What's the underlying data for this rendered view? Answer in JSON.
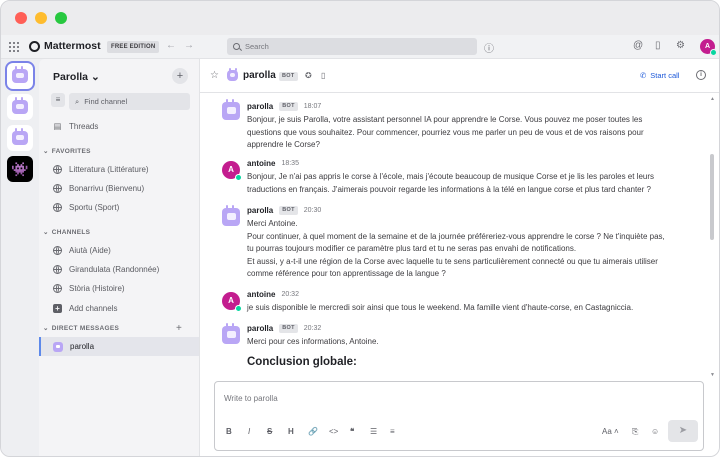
{
  "app": {
    "brand": "Mattermost",
    "edition": "FREE EDITION",
    "search_placeholder": "Search",
    "user_initial": "A"
  },
  "sidebar": {
    "team_name": "Parolla",
    "find_placeholder": "Find channel",
    "threads_label": "Threads",
    "favorites_header": "FAVORITES",
    "favorites": [
      "Litteratura (Littérature)",
      "Bonarrivu (Bienvenu)",
      "Sportu (Sport)"
    ],
    "channels_header": "CHANNELS",
    "channels": [
      "Aiutà (Aide)",
      "Girandulata (Randonnée)",
      "Stòria (Histoire)"
    ],
    "add_channels_label": "Add channels",
    "dm_header": "DIRECT MESSAGES",
    "dms": [
      "parolla"
    ]
  },
  "channel": {
    "name": "parolla",
    "bot_tag": "BOT",
    "start_call_label": "Start call"
  },
  "messages": [
    {
      "author": "parolla",
      "bot": "BOT",
      "time": "18:07",
      "text": "Bonjour, je suis Parolla, votre assistant personnel IA pour apprendre le Corse. Vous pouvez me poser toutes les questions que vous souhaitez. Pour commencer, pourriez vous me parler un peu de vous et de vos raisons pour apprendre le Corse?"
    },
    {
      "author": "antoine",
      "time": "18:35",
      "text": "Bonjour, Je n'ai pas appris le corse à l'école, mais j'écoute beaucoup de musique Corse et je lis les paroles et leurs traductions en français. J'aimerais pouvoir regarde les informations à la télé en langue corse et plus tard chanter ?"
    },
    {
      "author": "parolla",
      "bot": "BOT",
      "time": "20:30",
      "lines": [
        "Merci Antoine.",
        "Pour continuer, à quel moment de la semaine et de la journée préféreriez-vous apprendre le corse ? Ne t'inquiète pas, tu pourras toujours modifier ce paramètre plus tard et tu ne seras pas envahi de notifications.",
        "Et aussi, y a-t-il une région de la Corse avec laquelle tu te sens particulièrement connecté ou que tu aimerais utiliser comme référence pour ton apprentissage de la langue ?"
      ]
    },
    {
      "author": "antoine",
      "time": "20:32",
      "text": "je suis disponible le mercredi soir ainsi que tous le weekend. Ma famille vient d'haute-corse, en Castagniccia."
    },
    {
      "author": "parolla",
      "bot": "BOT",
      "time": "20:32",
      "text": "Merci pour ces informations, Antoine.",
      "heading": "Conclusion globale:"
    }
  ],
  "composer": {
    "placeholder": "Write to parolla",
    "format_buttons": [
      "B",
      "I",
      "S",
      "H",
      "🔗",
      "<>",
      "❝",
      "☰",
      "≡"
    ],
    "font_toggle": "Aa"
  },
  "colors": {
    "accent": "#1c58d9",
    "avatar_user": "#c31d8f",
    "online": "#06d6a0",
    "bot_avatar": "#b9a6f5"
  }
}
